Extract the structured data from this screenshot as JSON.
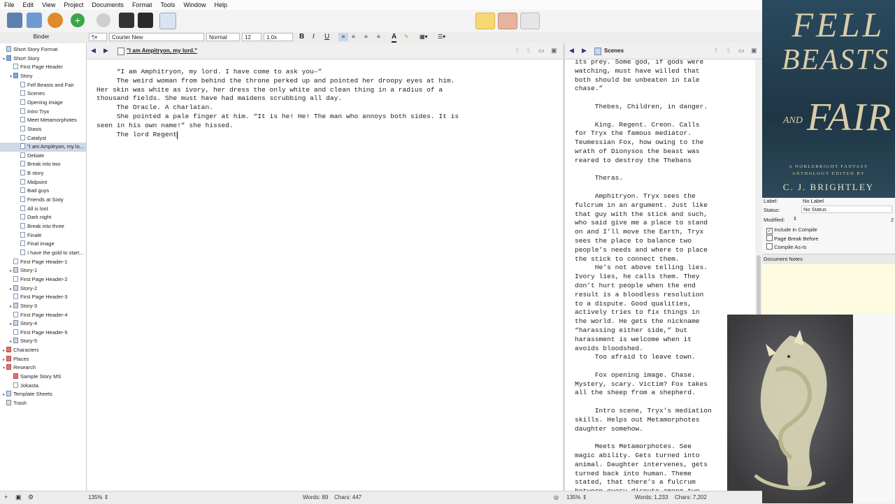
{
  "menu": [
    "File",
    "Edit",
    "View",
    "Project",
    "Documents",
    "Format",
    "Tools",
    "Window",
    "Help"
  ],
  "formatbar": {
    "font": "Courier New",
    "style": "Normal",
    "size": "12",
    "spacing": "1.0x"
  },
  "binder": {
    "header": "Binder",
    "items": [
      {
        "label": "Short Story Format",
        "indent": 0,
        "icon": "stack",
        "tog": ""
      },
      {
        "label": "Short Story",
        "indent": 0,
        "icon": "folder",
        "tog": "▾"
      },
      {
        "label": "First Page Header",
        "indent": 1,
        "icon": "doc",
        "tog": ""
      },
      {
        "label": "Story",
        "indent": 1,
        "icon": "folder",
        "tog": "▾"
      },
      {
        "label": "Fell Beasts and Fair",
        "indent": 2,
        "icon": "doc",
        "tog": ""
      },
      {
        "label": "Scenes",
        "indent": 2,
        "icon": "doc",
        "tog": ""
      },
      {
        "label": "Opening image",
        "indent": 2,
        "icon": "doc",
        "tog": ""
      },
      {
        "label": "Intro Tryx",
        "indent": 2,
        "icon": "doc",
        "tog": ""
      },
      {
        "label": "Meet Metamorphotes",
        "indent": 2,
        "icon": "doc",
        "tog": ""
      },
      {
        "label": "Stasis",
        "indent": 2,
        "icon": "doc",
        "tog": ""
      },
      {
        "label": "Catalyst",
        "indent": 2,
        "icon": "doc",
        "tog": ""
      },
      {
        "label": "\"I am Ampitryon, my lo...",
        "indent": 2,
        "icon": "doc",
        "tog": "",
        "sel": true
      },
      {
        "label": "Debate",
        "indent": 2,
        "icon": "doc",
        "tog": ""
      },
      {
        "label": "Break into two",
        "indent": 2,
        "icon": "doc",
        "tog": ""
      },
      {
        "label": "B story",
        "indent": 2,
        "icon": "doc",
        "tog": ""
      },
      {
        "label": "Midpoint",
        "indent": 2,
        "icon": "doc",
        "tog": ""
      },
      {
        "label": "Bad guys",
        "indent": 2,
        "icon": "doc",
        "tog": ""
      },
      {
        "label": "Friends at Sixty",
        "indent": 2,
        "icon": "doc",
        "tog": ""
      },
      {
        "label": "All is lost",
        "indent": 2,
        "icon": "doc",
        "tog": ""
      },
      {
        "label": "Dark night",
        "indent": 2,
        "icon": "doc",
        "tog": ""
      },
      {
        "label": "Break into three",
        "indent": 2,
        "icon": "doc",
        "tog": ""
      },
      {
        "label": "Finale",
        "indent": 2,
        "icon": "doc",
        "tog": ""
      },
      {
        "label": "Final image",
        "indent": 2,
        "icon": "doc",
        "tog": ""
      },
      {
        "label": "I have the gold to start...",
        "indent": 2,
        "icon": "doc",
        "tog": ""
      },
      {
        "label": "First Page Header-1",
        "indent": 1,
        "icon": "doc",
        "tog": ""
      },
      {
        "label": "Story-1",
        "indent": 1,
        "icon": "stack",
        "tog": "▸"
      },
      {
        "label": "First Page Header-2",
        "indent": 1,
        "icon": "doc",
        "tog": ""
      },
      {
        "label": "Story-2",
        "indent": 1,
        "icon": "stack",
        "tog": "▸"
      },
      {
        "label": "First Page Header-3",
        "indent": 1,
        "icon": "doc",
        "tog": ""
      },
      {
        "label": "Story-3",
        "indent": 1,
        "icon": "stack",
        "tog": "▸"
      },
      {
        "label": "First Page Header-4",
        "indent": 1,
        "icon": "doc",
        "tog": ""
      },
      {
        "label": "Story-4",
        "indent": 1,
        "icon": "stack",
        "tog": "▸"
      },
      {
        "label": "First Page Header-5",
        "indent": 1,
        "icon": "doc",
        "tog": ""
      },
      {
        "label": "Story-5",
        "indent": 1,
        "icon": "stack",
        "tog": "▸"
      },
      {
        "label": "Characters",
        "indent": 0,
        "icon": "red",
        "tog": "▸"
      },
      {
        "label": "Places",
        "indent": 0,
        "icon": "red",
        "tog": "▸"
      },
      {
        "label": "Research",
        "indent": 0,
        "icon": "red",
        "tog": "▾"
      },
      {
        "label": "Sample Story MS",
        "indent": 1,
        "icon": "red",
        "tog": ""
      },
      {
        "label": "Jokasta.",
        "indent": 1,
        "icon": "doc",
        "tog": ""
      },
      {
        "label": "Template Sheets",
        "indent": 0,
        "icon": "stack",
        "tog": "▸"
      },
      {
        "label": "Trash",
        "indent": 0,
        "icon": "trash",
        "tog": ""
      }
    ]
  },
  "editor": {
    "doc_title": "\"I am Ampitryon, my lord.\"",
    "lines": [
      "     “I am Amphitryon, my lord. I have come to ask you–”",
      "     The weird woman from behind the throne perked up and pointed her droopy eyes at him.",
      "Her skin was white as ivory, her dress the only white and clean thing in a radius of a",
      "thousand fields. She must have had maidens scrubbing all day.",
      "     The Oracle. A charlatan.",
      "     She pointed a pale finger at him. “It is he! He! The man who annoys both sides. It is",
      "seen in his own name!” she hissed.",
      "     The lord Regent"
    ]
  },
  "scenes": {
    "title": "Scenes",
    "lines": [
      "its prey. Some god, if gods were",
      "watching, must have willed that",
      "both should be unbeaten in tale",
      "chase.”",
      "",
      "     Thebes, Children, in danger.",
      "",
      "     King. Regent. Creon. Calls",
      "for Tryx the famous mediator.",
      "Teumessian Fox, how owing to the",
      "wrath of Dionysos the beast was",
      "reared to destroy the Thebans",
      "",
      "     Theras.",
      "",
      "     Amphitryon. Tryx sees the",
      "fulcrum in an argument. Just like",
      "that guy with the stick and such,",
      "who said give me a place to stand",
      "on and I’ll move the Earth, Tryx",
      "sees the place to balance two",
      "people’s needs and where to place",
      "the stick to connect them.",
      "     He’s not above telling lies.",
      "Ivory lies, he calls them. They",
      "don’t hurt people when the end",
      "result is a bloodless resolution",
      "to a dispute. Good qualities,",
      "actively tries to fix things in",
      "the world. He gets the nickname",
      "“harassing either side,” but",
      "harassment is welcome when it",
      "avoids bloodshed.",
      "     Too afraid to leave town.",
      "",
      "     Fox opening image. Chase.",
      "Mystery, scary. Victim? Fox takes",
      "all the sheep from a shepherd.",
      "",
      "     Intro scene, Tryx’s mediation",
      "skills. Helps out Metamorphotes",
      "daughter somehow.",
      "",
      "     Meets Metamorphotes. See",
      "magic ability. Gets turned into",
      "animal. Daughter intervenes, gets",
      "turned back into human. Theme",
      "stated, that there’s a fulcrum",
      "between every dispute among two"
    ]
  },
  "cover": {
    "title_line1": "FELL",
    "title_line2": "BEASTS",
    "title_and": "AND",
    "title_line3": "FAIR",
    "subtitle1": "A NOBLEBRIGHT FANTASY",
    "subtitle2": "ANTHOLOGY EDITED BY",
    "author": "C. J. BRIGHTLEY"
  },
  "inspector": {
    "label_key": "Label:",
    "label_val": "No Label",
    "status_key": "Status:",
    "status_val": "No Status",
    "modified_key": "Modified:",
    "modified_val": "2",
    "include": "Include in Compile",
    "pagebreak": "Page Break Before",
    "compileas": "Compile As-Is",
    "notes_header": "Document Notes"
  },
  "status": {
    "binder_zoom": "135%",
    "editor_words": "Words: 89",
    "editor_chars": "Chars: 447",
    "scenes_zoom": "135%",
    "scenes_words": "Words: 1,233",
    "scenes_chars": "Chars: 7,202"
  }
}
